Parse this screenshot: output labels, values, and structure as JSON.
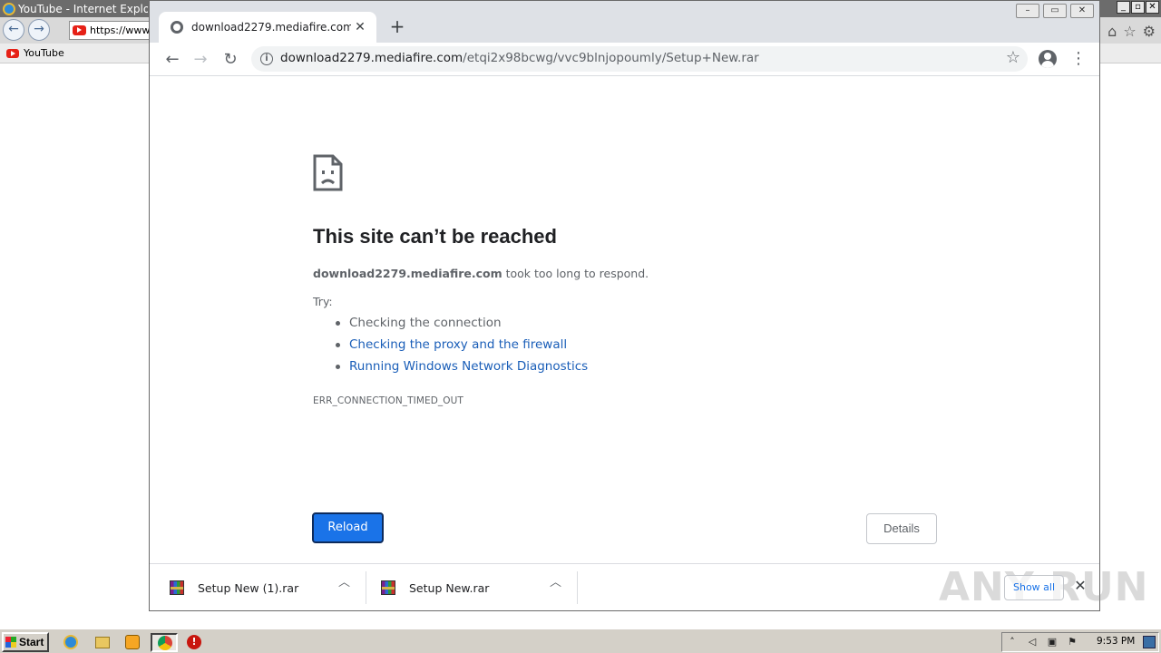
{
  "ie": {
    "title": "YouTube - Internet Explorer",
    "address": "https://www.",
    "favorite": "YouTube"
  },
  "chrome": {
    "tab_title": "download2279.mediafire.com",
    "url_host": "download2279.mediafire.com",
    "url_path": "/etqi2x98bcwg/vvc9blnjopoumly/Setup+New.rar"
  },
  "error": {
    "title": "This site can’t be reached",
    "host": "download2279.mediafire.com",
    "message": " took too long to respond.",
    "try_label": "Try:",
    "suggestions": [
      "Checking the connection",
      "Checking the proxy and the firewall",
      "Running Windows Network Diagnostics"
    ],
    "code": "ERR_CONNECTION_TIMED_OUT",
    "reload_label": "Reload",
    "details_label": "Details"
  },
  "downloads": {
    "items": [
      {
        "name": "Setup New (1).rar",
        "icon": "winrar-archive-icon"
      },
      {
        "name": "Setup New.rar",
        "icon": "winrar-archive-icon"
      }
    ],
    "show_all_label": "Show all"
  },
  "watermark": "ANY RUN",
  "taskbar": {
    "start_label": "Start",
    "clock": "9:53 PM"
  },
  "colors": {
    "reload_button": "#1a73e8",
    "link": "#1a5eb8",
    "chrome_frame": "#dee1e6",
    "taskbar": "#d4d0c8"
  }
}
